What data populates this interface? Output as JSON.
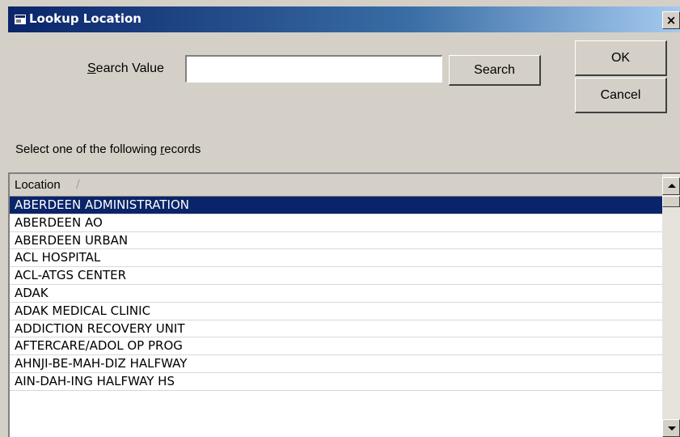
{
  "window": {
    "title": "Lookup Location",
    "close_glyph": "×"
  },
  "search": {
    "label_prefix": "",
    "label_accel": "S",
    "label_rest": "earch Value",
    "value": "",
    "placeholder": "",
    "button_label": "Search"
  },
  "actions": {
    "ok_label": "OK",
    "cancel_label": "Cancel"
  },
  "instructions": {
    "prefix": "Select one of the following ",
    "accel": "r",
    "rest": "ecords"
  },
  "grid": {
    "column_header": "Location",
    "sort_glyph": "/",
    "selected_index": 0,
    "rows": [
      "ABERDEEN ADMINISTRATION",
      "ABERDEEN AO",
      "ABERDEEN URBAN",
      "ACL HOSPITAL",
      "ACL-ATGS CENTER",
      "ADAK",
      "ADAK MEDICAL CLINIC",
      "ADDICTION RECOVERY UNIT",
      "AFTERCARE/ADOL OP PROG",
      "AHNJI-BE-MAH-DIZ HALFWAY",
      "AIN-DAH-ING HALFWAY HS"
    ]
  },
  "colors": {
    "titlebar_start": "#0a246a",
    "titlebar_end": "#a6caf0",
    "selection": "#0a246a",
    "dialog_face": "#d4d0c8"
  },
  "icons": {
    "title_icon": "app-window-icon",
    "scroll_up": "scroll-up-arrow-icon",
    "scroll_down": "scroll-down-arrow-icon"
  }
}
